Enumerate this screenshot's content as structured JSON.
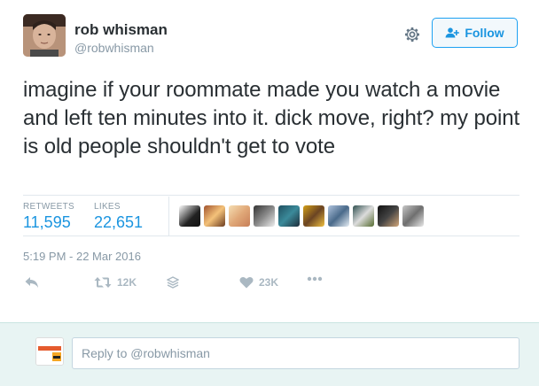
{
  "user": {
    "name": "rob whisman",
    "handle": "@robwhisman"
  },
  "follow_button": {
    "label": "Follow"
  },
  "tweet_text": "imagine if your roommate made you watch a movie and left ten minutes into it. dick move, right? my point is old people shouldn't get to vote",
  "stats": {
    "retweets_label": "RETWEETS",
    "retweets_value": "11,595",
    "likes_label": "LIKES",
    "likes_value": "22,651"
  },
  "timestamp": "5:19 PM - 22 Mar 2016",
  "actions": {
    "retweet_count": "12K",
    "like_count": "23K"
  },
  "reply": {
    "placeholder": "Reply to @robwhisman"
  },
  "colors": {
    "accent": "#1b95e0",
    "muted": "#8899a6",
    "reply_bg": "#e8f4f3"
  }
}
